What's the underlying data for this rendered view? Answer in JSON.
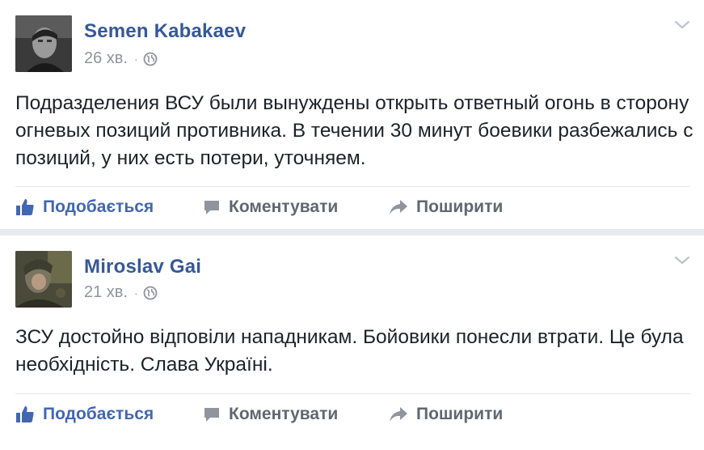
{
  "posts": [
    {
      "author": "Semen Kabakaev",
      "time": "26 хв.",
      "separator": "·",
      "avatar_icon": "avatar-photo-man-dark",
      "text": "Подразделения ВСУ были вынуждены открыть ответный огонь в сторону огневых позиций противника. В течении 30 минут боевики разбежались с позиций, у них есть потери, уточняем.",
      "actions": {
        "like": "Подобається",
        "comment": "Коментувати",
        "share": "Поширити"
      }
    },
    {
      "author": "Miroslav Gai",
      "time": "21 хв.",
      "separator": "·",
      "avatar_icon": "avatar-photo-soldier-camouflage",
      "text": "ЗСУ достойно відповіли нападникам. Бойовики понесли втрати. Це була необхідність. Слава Україні.",
      "actions": {
        "like": "Подобається",
        "comment": "Коментувати",
        "share": "Поширити"
      }
    }
  ],
  "colors": {
    "author": "#365899",
    "like_active": "#4267b2",
    "action_gray": "#616770",
    "meta_gray": "#90949c",
    "background": "#e9ebee"
  }
}
